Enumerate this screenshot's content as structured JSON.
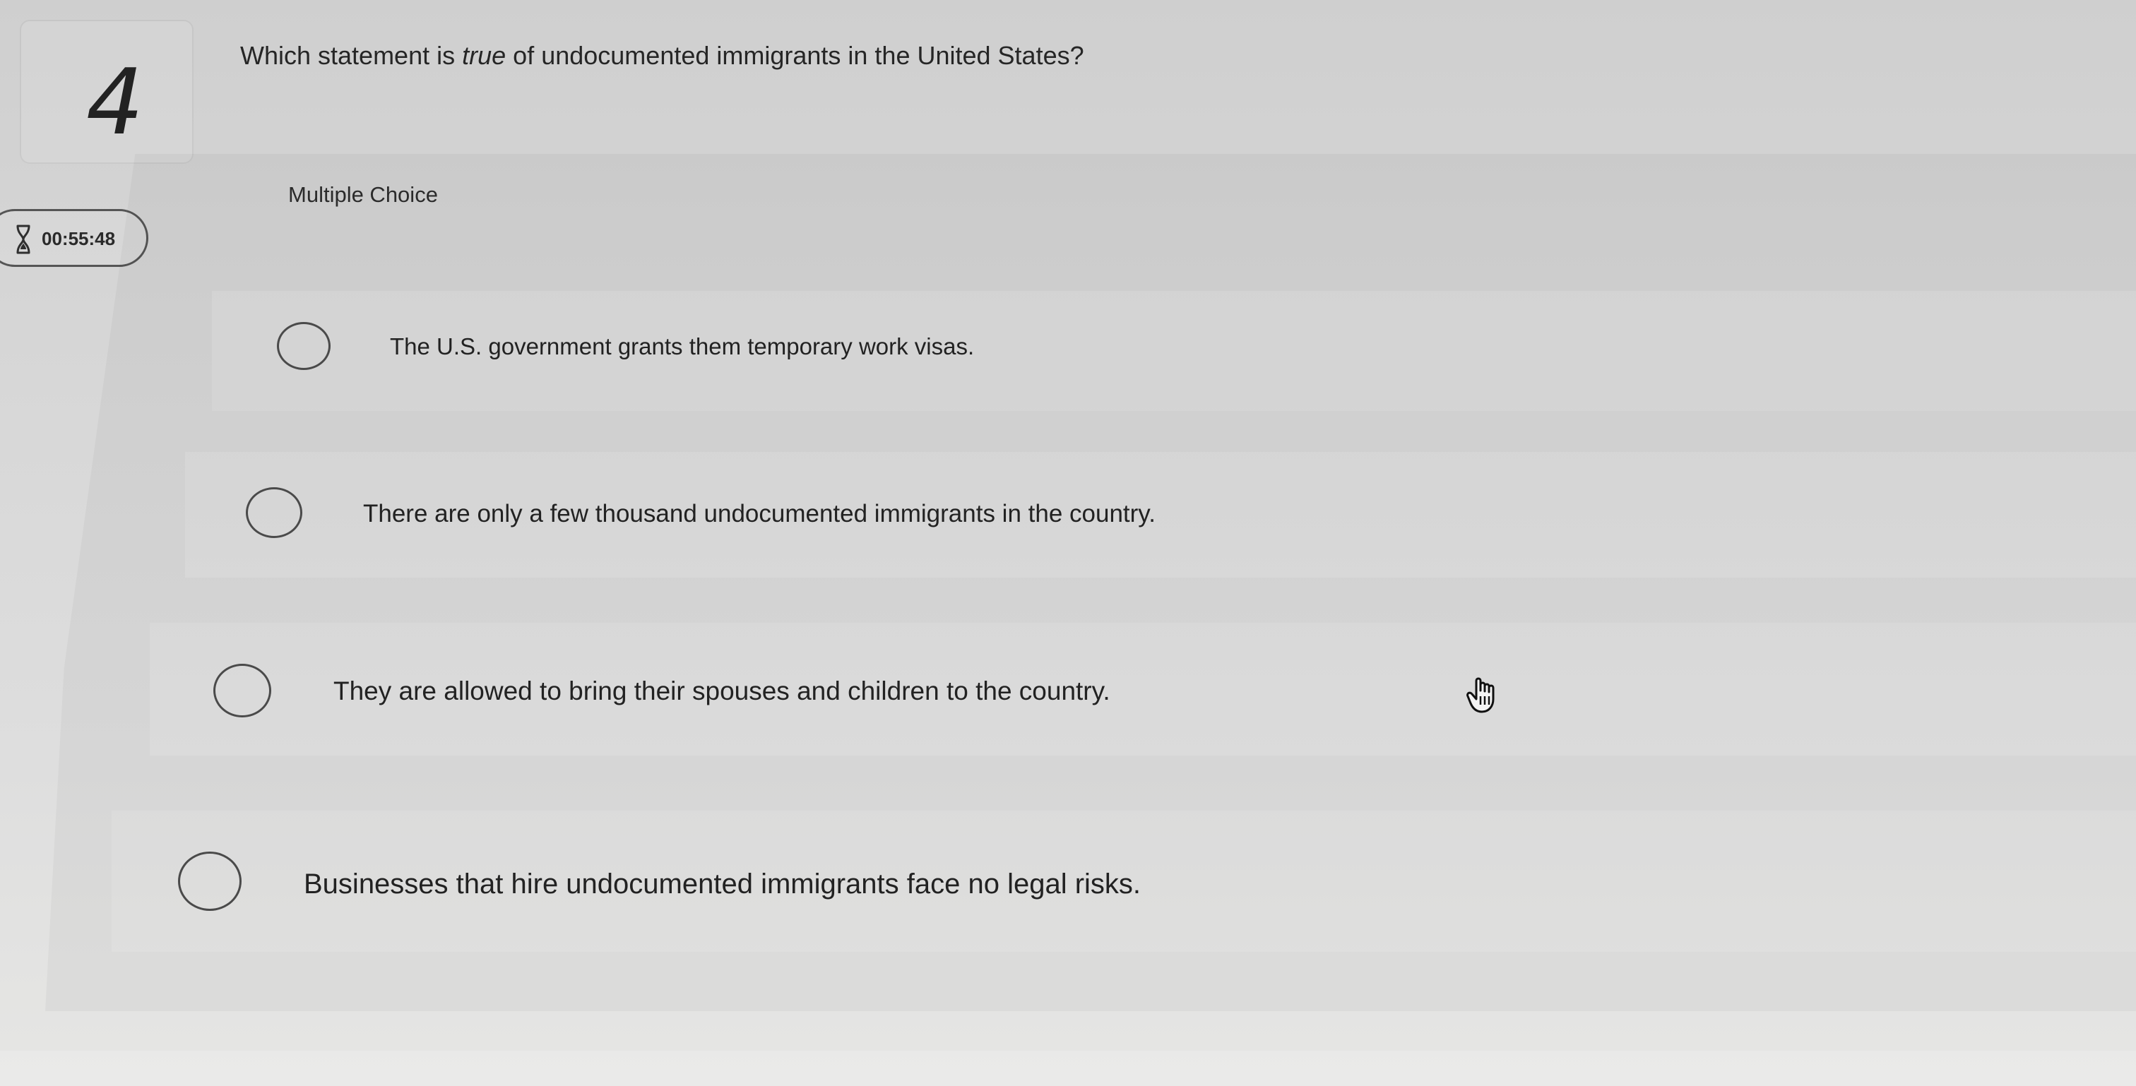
{
  "question": {
    "number": "4",
    "text_before": "Which statement is ",
    "text_emphasis": "true",
    "text_after": " of undocumented immigrants in the United States?"
  },
  "timer": {
    "icon": "hourglass-icon",
    "time": "00:55:48"
  },
  "answer_section": {
    "type_label": "Multiple Choice",
    "choices": [
      {
        "label": "The U.S. government grants them temporary work visas."
      },
      {
        "label": "There are only a few thousand undocumented immigrants in the country."
      },
      {
        "label": "They are allowed to bring their spouses and children to the country."
      },
      {
        "label": "Businesses that hire undocumented immigrants face no legal risks."
      }
    ]
  },
  "cursor": {
    "icon": "hand-pointer-icon"
  }
}
